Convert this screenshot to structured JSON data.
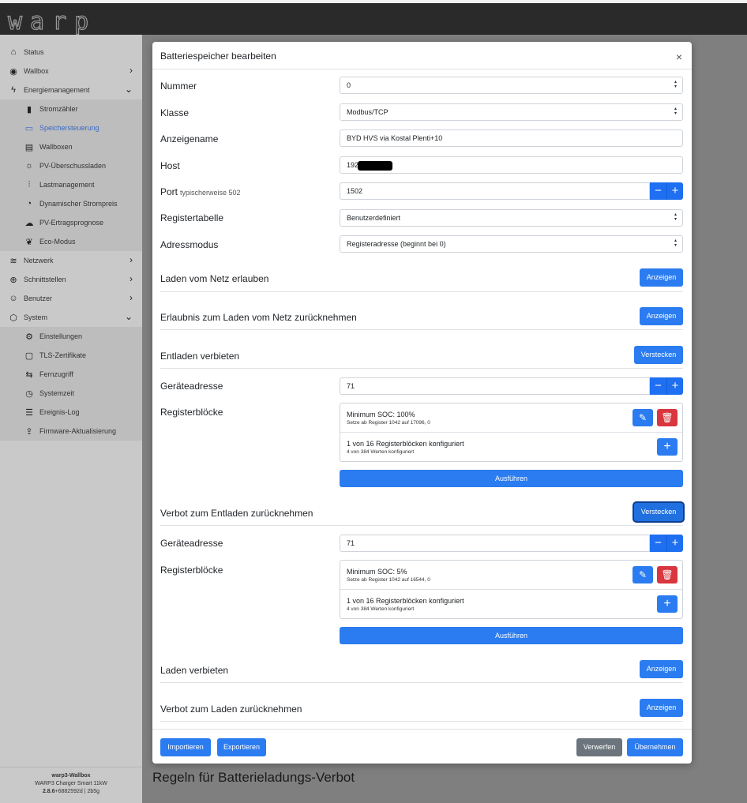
{
  "app": {
    "logo_text": "warp"
  },
  "sidebar": {
    "items": [
      {
        "label": "Status",
        "icon": "home-icon"
      },
      {
        "label": "Wallbox",
        "icon": "wallbox-icon"
      },
      {
        "label": "Energiemanagement",
        "icon": "bolt-icon"
      },
      {
        "label": "Stromzähler",
        "icon": "bar-chart-icon"
      },
      {
        "label": "Speichersteuerung",
        "icon": "battery-icon"
      },
      {
        "label": "Wallboxen",
        "icon": "wallboxes-icon"
      },
      {
        "label": "PV-Überschussladen",
        "icon": "sun-icon"
      },
      {
        "label": "Lastmanagement",
        "icon": "sliders-icon"
      },
      {
        "label": "Dynamischer Strompreis",
        "icon": "price-icon"
      },
      {
        "label": "PV-Ertragsprognose",
        "icon": "forecast-icon"
      },
      {
        "label": "Eco-Modus",
        "icon": "leaf-icon"
      },
      {
        "label": "Netzwerk",
        "icon": "wifi-icon"
      },
      {
        "label": "Schnittstellen",
        "icon": "globe-icon"
      },
      {
        "label": "Benutzer",
        "icon": "user-icon"
      },
      {
        "label": "System",
        "icon": "box-icon"
      },
      {
        "label": "Einstellungen",
        "icon": "gear-icon"
      },
      {
        "label": "TLS-Zertifikate",
        "icon": "certificate-icon"
      },
      {
        "label": "Fernzugriff",
        "icon": "remote-icon"
      },
      {
        "label": "Systemzeit",
        "icon": "clock-icon"
      },
      {
        "label": "Ereignis-Log",
        "icon": "log-icon"
      },
      {
        "label": "Firmware-Aktualisierung",
        "icon": "upload-icon"
      }
    ],
    "footer": {
      "device": "warp3-Wallbox",
      "model": "WARP3 Charger Smart 11kW",
      "version": "2.8.6",
      "build": "+6882592d | 2b5g"
    }
  },
  "background": {
    "heading": "Regeln für Batterieladungs-Verbot"
  },
  "modal": {
    "title": "Batteriespeicher bearbeiten",
    "close": "×",
    "nummer": {
      "label": "Nummer",
      "value": "0"
    },
    "klasse": {
      "label": "Klasse",
      "value": "Modbus/TCP"
    },
    "anzeigename": {
      "label": "Anzeigename",
      "value": "BYD HVS via Kostal Plenti+10"
    },
    "host": {
      "label": "Host",
      "value": "192."
    },
    "port": {
      "label": "Port",
      "hint": "typischerweise 502",
      "value": "1502"
    },
    "registertabelle": {
      "label": "Registertabelle",
      "value": "Benutzerdefiniert"
    },
    "adressmodus": {
      "label": "Adressmodus",
      "value": "Registeradresse (beginnt bei 0)"
    },
    "sections": {
      "laden_netz": {
        "label": "Laden vom Netz erlauben",
        "button": "Anzeigen"
      },
      "erlaubnis_netz": {
        "label": "Erlaubnis zum Laden vom Netz zurücknehmen",
        "button": "Anzeigen"
      },
      "entladen_verbieten": {
        "label": "Entladen verbieten",
        "button": "Verstecken",
        "geraeteadresse_label": "Geräteadresse",
        "geraeteadresse": "71",
        "registerbloecke_label": "Registerblöcke",
        "block_title": "Minimum SOC: 100%",
        "block_detail": "Setze ab Register 1042 auf 17096, 0",
        "summary": "1 von 16 Registerblöcken konfiguriert",
        "summary_detail": "4 von 384 Werten konfiguriert",
        "run": "Ausführen"
      },
      "verbot_entladen": {
        "label": "Verbot zum Entladen zurücknehmen",
        "button": "Verstecken",
        "geraeteadresse_label": "Geräteadresse",
        "geraeteadresse": "71",
        "registerbloecke_label": "Registerblöcke",
        "block_title": "Minimum SOC: 5%",
        "block_detail": "Setze ab Register 1042 auf 16544, 0",
        "summary": "1 von 16 Registerblöcken konfiguriert",
        "summary_detail": "4 von 384 Werten konfiguriert",
        "run": "Ausführen"
      },
      "laden_verbieten": {
        "label": "Laden verbieten",
        "button": "Anzeigen"
      },
      "verbot_laden": {
        "label": "Verbot zum Laden zurücknehmen",
        "button": "Anzeigen"
      }
    },
    "footer": {
      "import": "Importieren",
      "export": "Exportieren",
      "discard": "Verwerfen",
      "apply": "Übernehmen"
    }
  },
  "colors": {
    "primary": "#2b7cf0",
    "danger": "#d9363e",
    "secondary": "#6c757d"
  }
}
